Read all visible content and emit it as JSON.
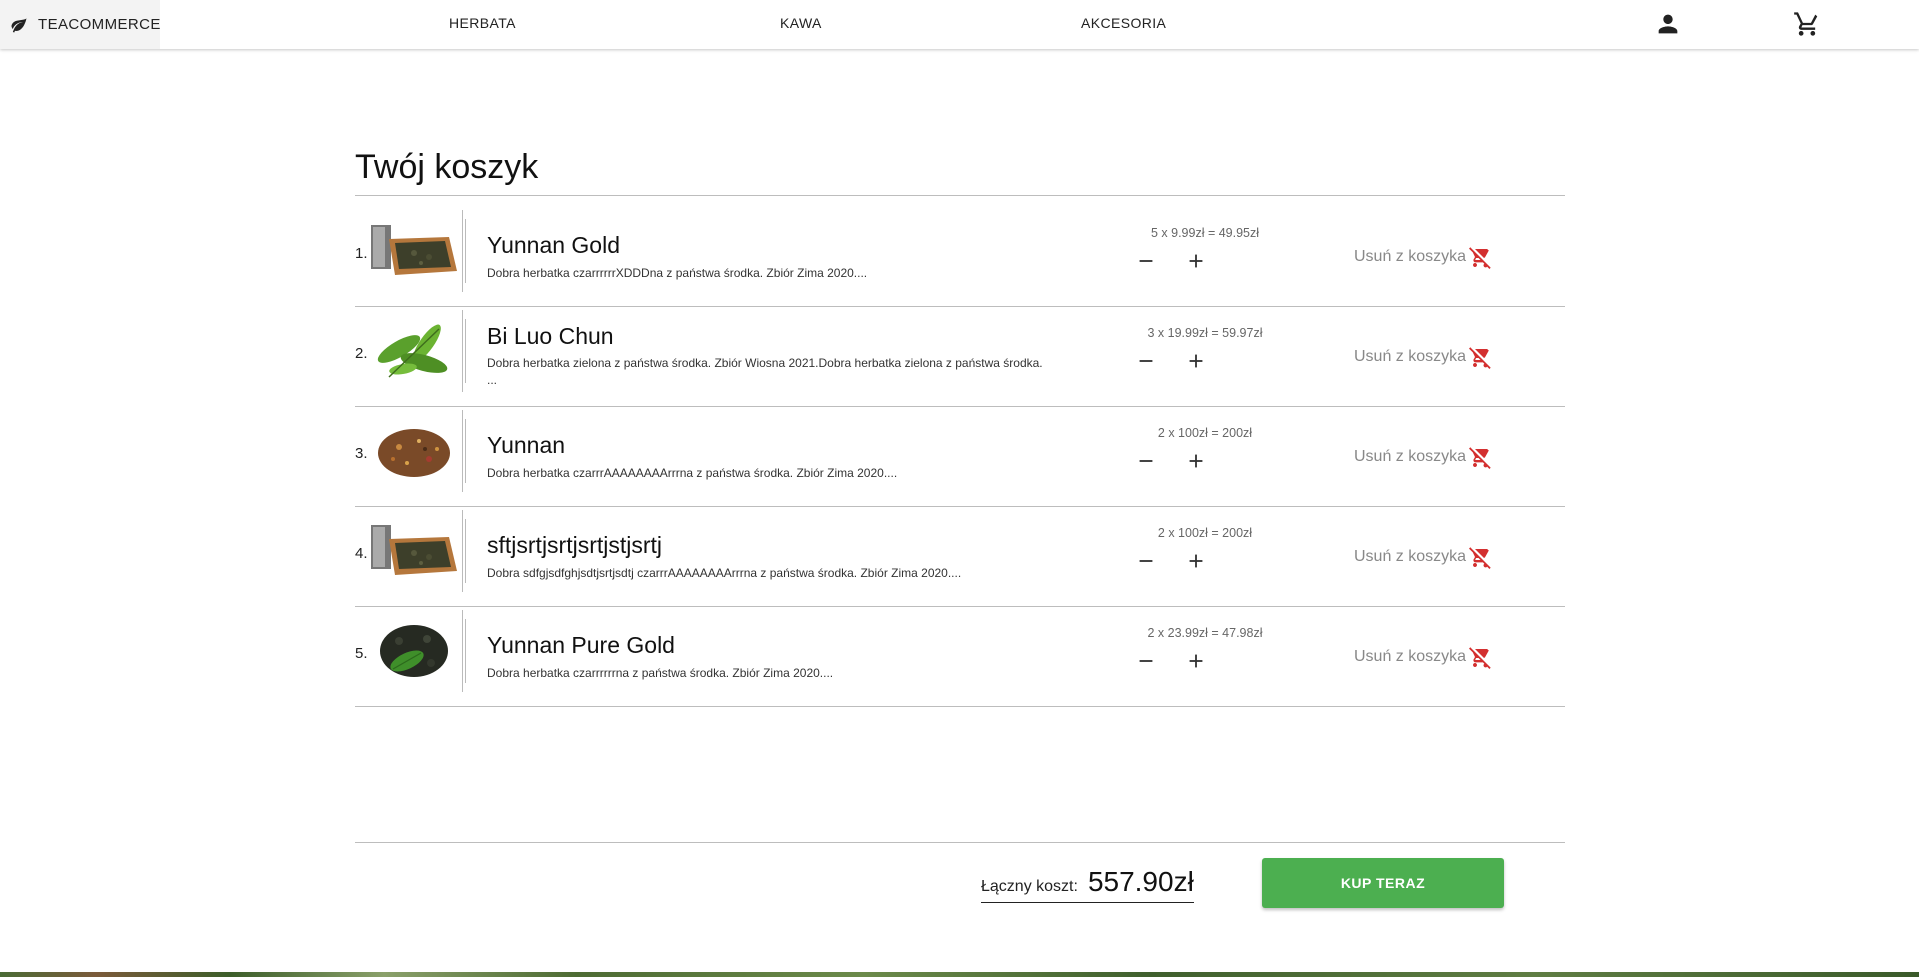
{
  "nav": {
    "brand": "TEACOMMERCE",
    "links": [
      "HERBATA",
      "KAWA",
      "AKCESORIA"
    ],
    "icons": {
      "brand": "leaf-icon",
      "account": "account-icon",
      "cart": "cart-icon"
    }
  },
  "cart": {
    "title": "Twój koszyk",
    "remove_label": "Usuń z koszyka",
    "items": [
      {
        "index": "1.",
        "name": "Yunnan Gold",
        "description": "Dobra herbatka czarrrrrrXDDDna z państwa środka. Zbiór Zima 2020....",
        "calc": "5 x 9.99zł = 49.95zł",
        "quantity": 5,
        "unit_price": "9.99zł",
        "subtotal": "49.95zł",
        "image": "tea-box-image"
      },
      {
        "index": "2.",
        "name": "Bi Luo Chun",
        "description": "Dobra herbatka zielona z państwa środka. Zbiór Wiosna 2021.Dobra herbatka zielona z państwa środka. ...",
        "calc": "3 x 19.99zł = 59.97zł",
        "quantity": 3,
        "unit_price": "19.99zł",
        "subtotal": "59.97zł",
        "image": "green-tea-leaves-image"
      },
      {
        "index": "3.",
        "name": "Yunnan",
        "description": "Dobra herbatka czarrrAAAAAAAArrrna z państwa środka. Zbiór Zima 2020....",
        "calc": "2 x 100zł = 200zł",
        "quantity": 2,
        "unit_price": "100zł",
        "subtotal": "200zł",
        "image": "loose-tea-image"
      },
      {
        "index": "4.",
        "name": "sftjsrtjsrtjsrtjstjsrtj",
        "description": "Dobra sdfgjsdfghjsdtjsrtjsdtj czarrrAAAAAAAArrrna z państwa środka. Zbiór Zima 2020....",
        "calc": "2 x 100zł = 200zł",
        "quantity": 2,
        "unit_price": "100zł",
        "subtotal": "200zł",
        "image": "tea-box-image"
      },
      {
        "index": "5.",
        "name": "Yunnan Pure Gold",
        "description": "Dobra herbatka czarrrrrrna z państwa środka. Zbiór Zima 2020....",
        "calc": "2 x 23.99zł = 47.98zł",
        "quantity": 2,
        "unit_price": "23.99zł",
        "subtotal": "47.98zł",
        "image": "dark-tea-leaf-image"
      }
    ],
    "total_label": "Łączny koszt:",
    "total_value": "557.90zł",
    "buy_label": "KUP TERAZ"
  },
  "colors": {
    "accent": "#4caf50",
    "remove_icon": "#d32f2f",
    "muted": "#888888"
  }
}
